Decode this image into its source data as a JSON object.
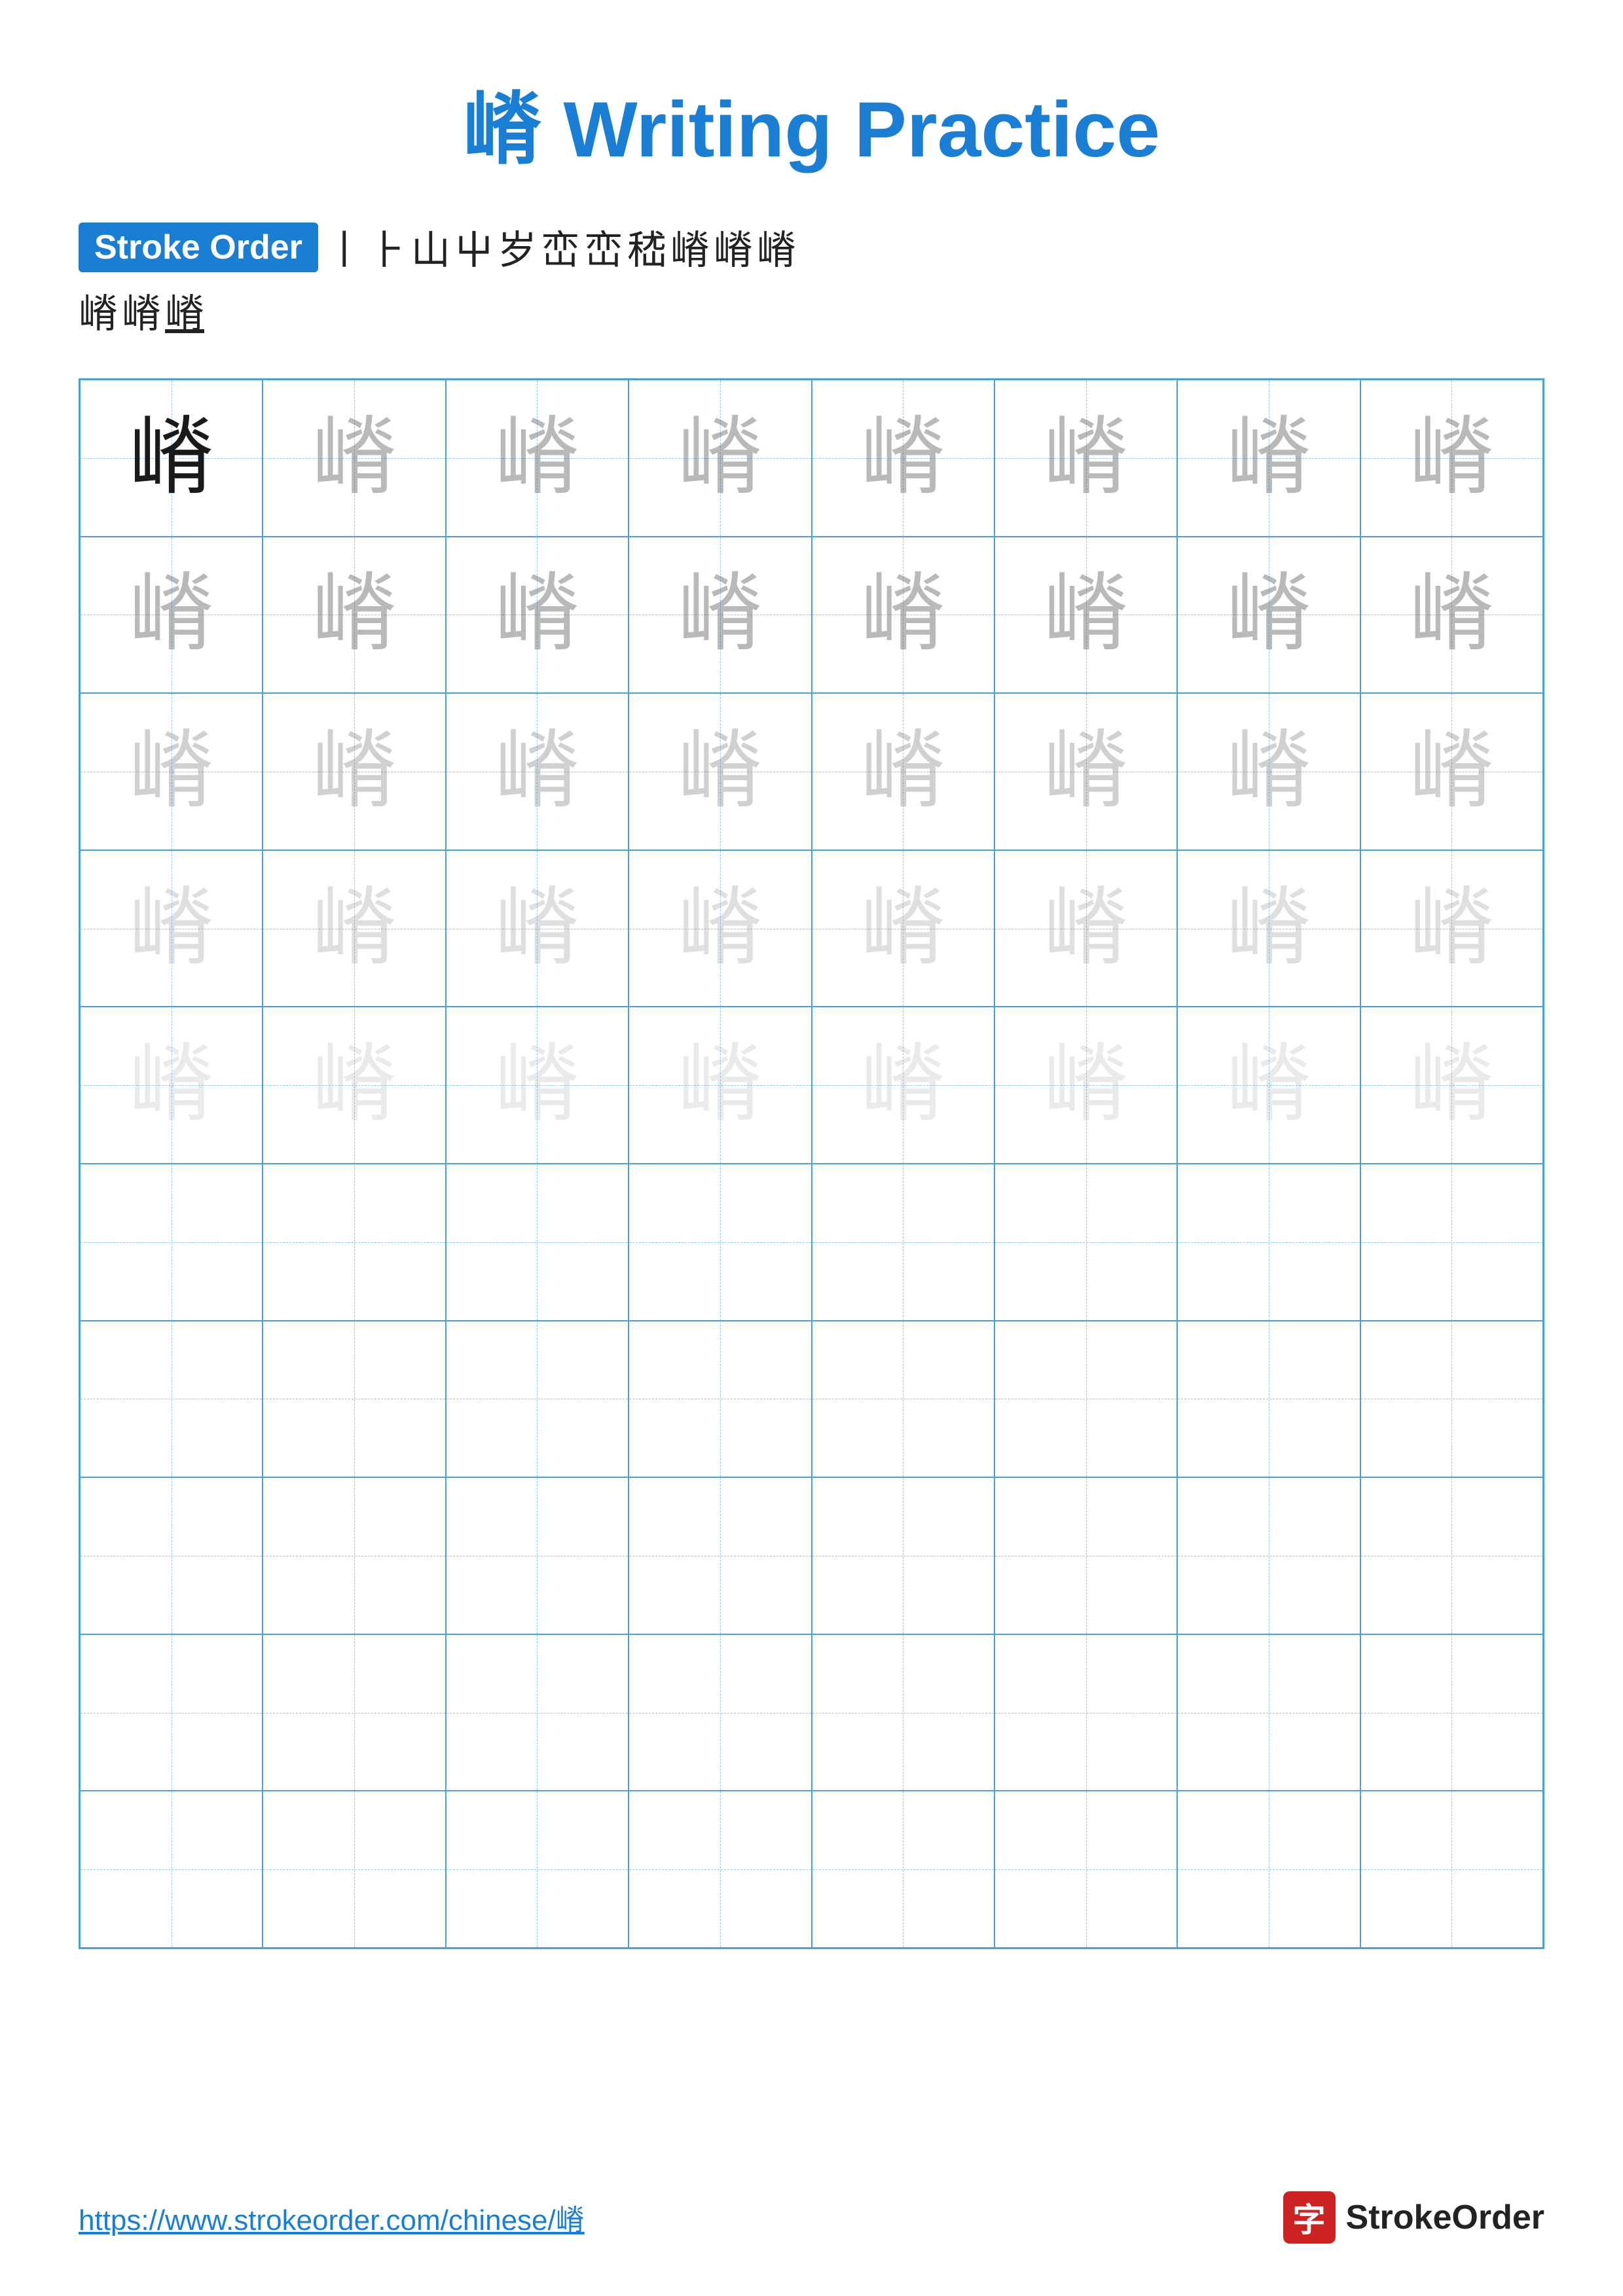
{
  "title": {
    "char": "嵴",
    "label": "Writing Practice",
    "full": "嵴 Writing Practice"
  },
  "stroke_order": {
    "badge_label": "Stroke Order",
    "strokes_row1": [
      "丨",
      "⺊",
      "山",
      "屮",
      "岁",
      "岁'",
      "岁<",
      "岁<<",
      "岁<<<",
      "嵴",
      "嵴"
    ],
    "strokes_row2": [
      "嵴",
      "嵴",
      "嵴"
    ]
  },
  "practice_char": "嵴",
  "grid": {
    "cols": 8,
    "rows": 10,
    "practice_rows": 5,
    "empty_rows": 5
  },
  "footer": {
    "url": "https://www.strokeorder.com/chinese/嵴",
    "logo_char": "字",
    "logo_name": "StrokeOrder"
  }
}
